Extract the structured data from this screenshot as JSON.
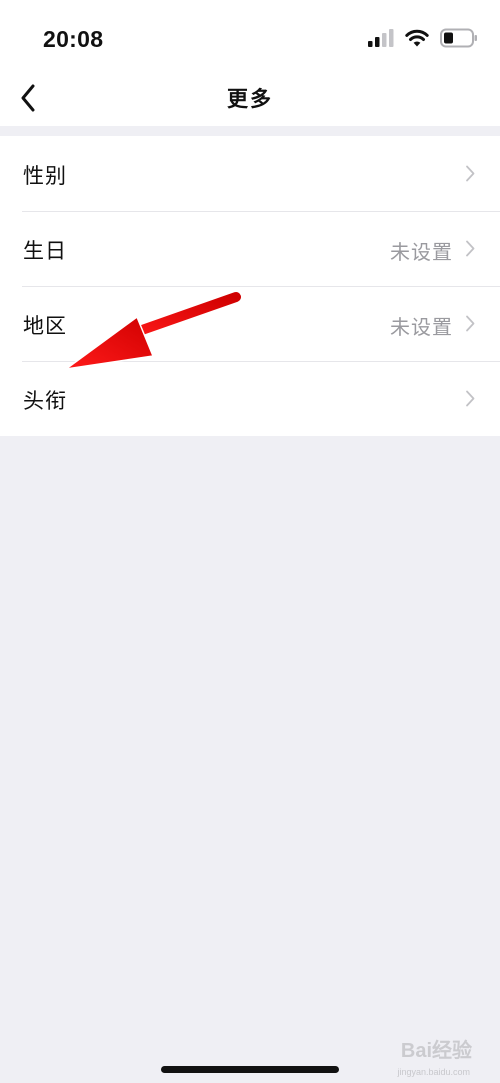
{
  "status_bar": {
    "time": "20:08",
    "icons": [
      "signal-icon",
      "wifi-icon",
      "battery-icon"
    ]
  },
  "nav": {
    "title": "更多",
    "back_icon": "chevron-left-icon"
  },
  "list": {
    "items": [
      {
        "label": "性别",
        "value": ""
      },
      {
        "label": "生日",
        "value": "未设置"
      },
      {
        "label": "地区",
        "value": "未设置"
      },
      {
        "label": "头衔",
        "value": ""
      }
    ]
  },
  "annotation": {
    "arrow_color": "#e8000b",
    "points_to": "头衔"
  },
  "watermark": {
    "text": "Bai经验",
    "sub": "jingyan.baidu.com"
  },
  "colors": {
    "background": "#efeff4",
    "surface": "#ffffff",
    "secondary_text": "#9a9a9f"
  }
}
